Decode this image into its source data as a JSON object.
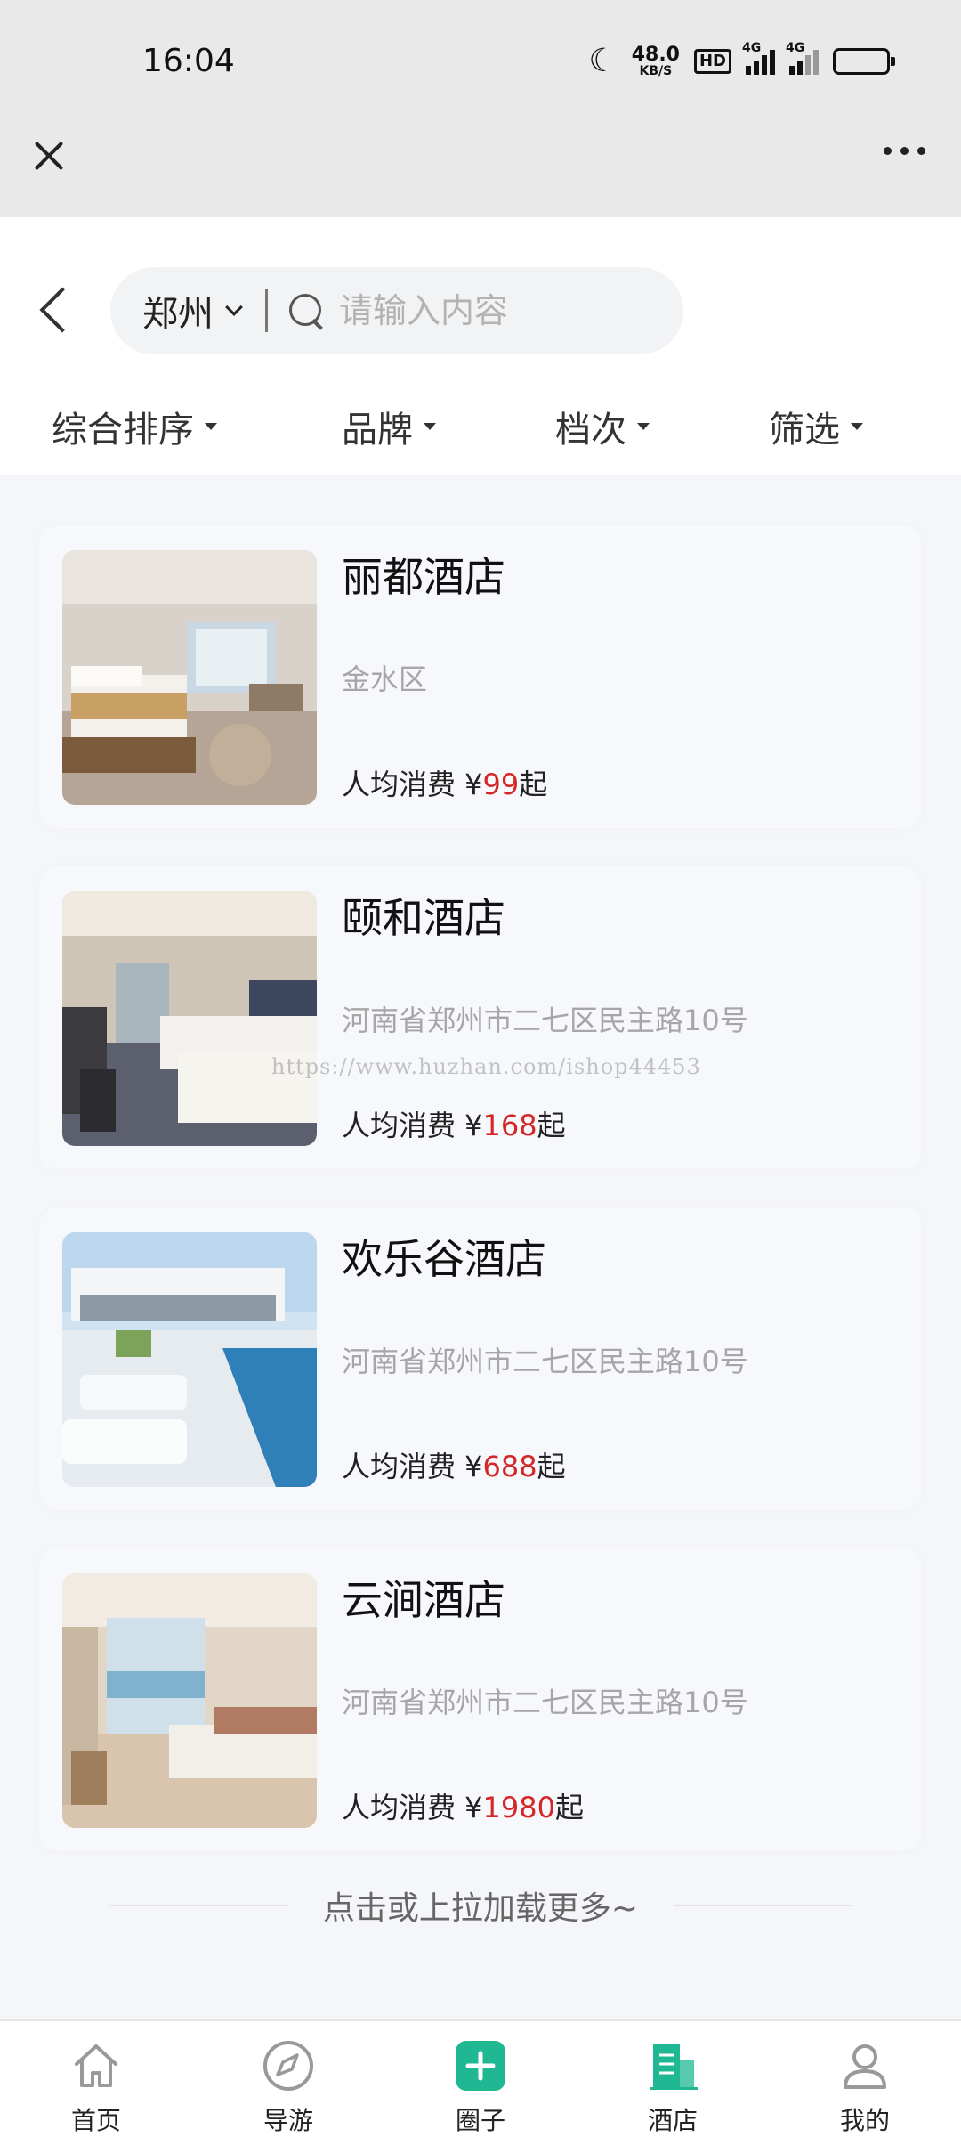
{
  "status_bar": {
    "time": "16:04",
    "net_speed": "48.0",
    "net_unit": "KB/S",
    "hd": "HD",
    "sig1": "4G",
    "sig2": "4G"
  },
  "search": {
    "city": "郑州",
    "placeholder": "请输入内容"
  },
  "filters": [
    "综合排序",
    "品牌",
    "档次",
    "筛选"
  ],
  "hotels": [
    {
      "name": "丽都酒店",
      "address": "金水区",
      "price_prefix": "人均消费 ¥",
      "price": "99",
      "price_suffix": "起"
    },
    {
      "name": "颐和酒店",
      "address": "河南省郑州市二七区民主路10号",
      "price_prefix": "人均消费 ¥",
      "price": "168",
      "price_suffix": "起"
    },
    {
      "name": "欢乐谷酒店",
      "address": "河南省郑州市二七区民主路10号",
      "price_prefix": "人均消费 ¥",
      "price": "688",
      "price_suffix": "起"
    },
    {
      "name": "云涧酒店",
      "address": "河南省郑州市二七区民主路10号",
      "price_prefix": "人均消费 ¥",
      "price": "1980",
      "price_suffix": "起"
    }
  ],
  "watermark": "https://www.huzhan.com/ishop44453",
  "load_more": "点击或上拉加载更多~",
  "tabbar": [
    {
      "label": "首页",
      "icon": "home-icon"
    },
    {
      "label": "导游",
      "icon": "compass-icon"
    },
    {
      "label": "圈子",
      "icon": "plus-icon"
    },
    {
      "label": "酒店",
      "icon": "hotel-icon"
    },
    {
      "label": "我的",
      "icon": "user-icon"
    }
  ],
  "colors": {
    "accent": "#1fb893",
    "price": "#d42727"
  }
}
